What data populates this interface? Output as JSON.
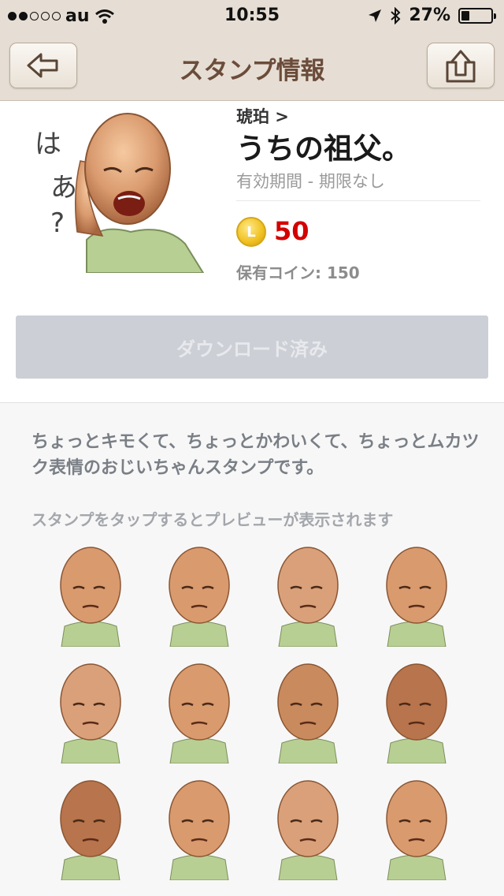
{
  "status_bar": {
    "carrier": "au",
    "time": "10:55",
    "battery": "27%",
    "battery_level": 0.27
  },
  "nav": {
    "title": "スタンプ情報",
    "back_icon": "back-arrow-icon",
    "share_icon": "share-icon"
  },
  "product": {
    "author": "琥珀 >",
    "title": "うちの祖父。",
    "validity": "有効期間 - 期限なし",
    "coin_letter": "L",
    "price": "50",
    "owned_label": "保有コイン: 150",
    "main_image_text_1": "は",
    "main_image_text_2": "あ",
    "main_image_text_3": "?"
  },
  "download_button": "ダウンロード済み",
  "description": "ちょっとキモくて、ちょっとかわいくて、ちょっとムカツク表情のおじいちゃんスタンプです。",
  "preview_hint": "スタンプをタップするとプレビューが表示されます",
  "stickers": [
    {
      "name": "sticker-1"
    },
    {
      "name": "sticker-2"
    },
    {
      "name": "sticker-3"
    },
    {
      "name": "sticker-4"
    },
    {
      "name": "sticker-5"
    },
    {
      "name": "sticker-6"
    },
    {
      "name": "sticker-7"
    },
    {
      "name": "sticker-8"
    },
    {
      "name": "sticker-9"
    },
    {
      "name": "sticker-10"
    },
    {
      "name": "sticker-11"
    },
    {
      "name": "sticker-12"
    }
  ],
  "colors": {
    "nav_bg": "#e6ded4",
    "title_brown": "#6b4c3a",
    "price_red": "#d40000",
    "disabled_button": "#cccfd6"
  }
}
